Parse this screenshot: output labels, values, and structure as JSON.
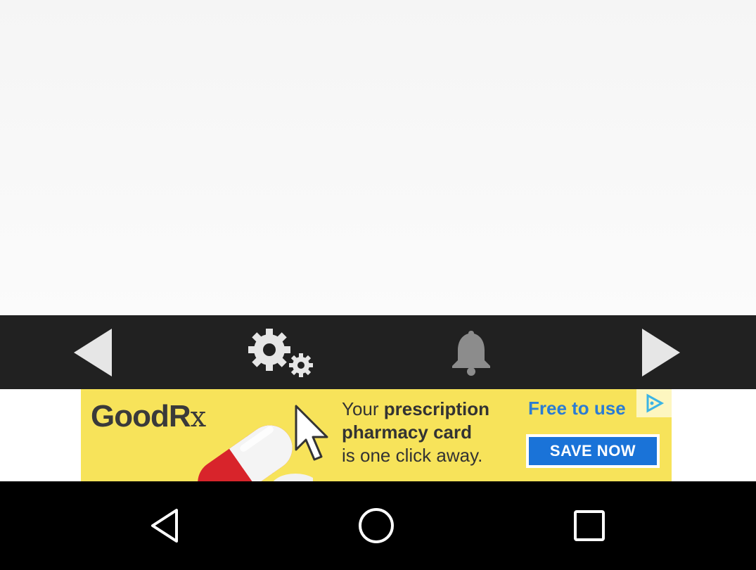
{
  "toolbar": {
    "icons": [
      "previous-arrow-icon",
      "settings-gears-icon",
      "notification-bell-icon",
      "next-arrow-icon"
    ],
    "icon_color": "#e6e6e6",
    "background": "#212121"
  },
  "ad": {
    "brand": "GoodR",
    "brand_suffix": "x",
    "line1_prefix": "Your ",
    "line1_bold": "prescription",
    "line2": "pharmacy card",
    "line3": "is one click away.",
    "free_text": "Free to use",
    "cta": "SAVE NOW",
    "background": "#f7e35a",
    "cta_color": "#1a73d8"
  },
  "navbar": {
    "icons": [
      "back-triangle-icon",
      "home-circle-icon",
      "recents-square-icon"
    ]
  }
}
